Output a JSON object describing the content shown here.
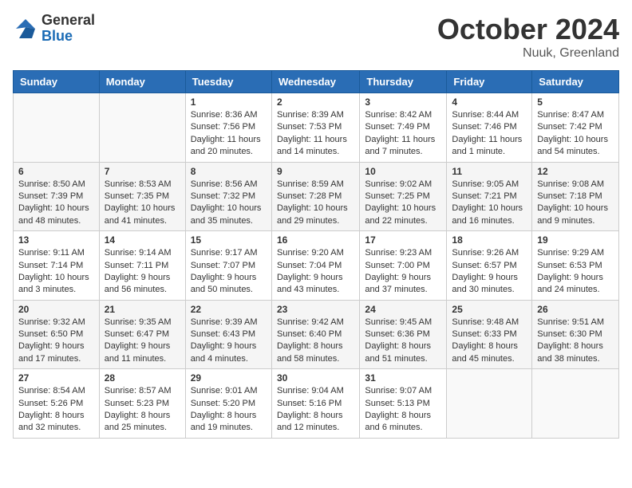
{
  "header": {
    "logo_general": "General",
    "logo_blue": "Blue",
    "month_title": "October 2024",
    "location": "Nuuk, Greenland"
  },
  "weekdays": [
    "Sunday",
    "Monday",
    "Tuesday",
    "Wednesday",
    "Thursday",
    "Friday",
    "Saturday"
  ],
  "rows": [
    [
      {
        "day": "",
        "lines": []
      },
      {
        "day": "",
        "lines": []
      },
      {
        "day": "1",
        "lines": [
          "Sunrise: 8:36 AM",
          "Sunset: 7:56 PM",
          "Daylight: 11 hours",
          "and 20 minutes."
        ]
      },
      {
        "day": "2",
        "lines": [
          "Sunrise: 8:39 AM",
          "Sunset: 7:53 PM",
          "Daylight: 11 hours",
          "and 14 minutes."
        ]
      },
      {
        "day": "3",
        "lines": [
          "Sunrise: 8:42 AM",
          "Sunset: 7:49 PM",
          "Daylight: 11 hours",
          "and 7 minutes."
        ]
      },
      {
        "day": "4",
        "lines": [
          "Sunrise: 8:44 AM",
          "Sunset: 7:46 PM",
          "Daylight: 11 hours",
          "and 1 minute."
        ]
      },
      {
        "day": "5",
        "lines": [
          "Sunrise: 8:47 AM",
          "Sunset: 7:42 PM",
          "Daylight: 10 hours",
          "and 54 minutes."
        ]
      }
    ],
    [
      {
        "day": "6",
        "lines": [
          "Sunrise: 8:50 AM",
          "Sunset: 7:39 PM",
          "Daylight: 10 hours",
          "and 48 minutes."
        ]
      },
      {
        "day": "7",
        "lines": [
          "Sunrise: 8:53 AM",
          "Sunset: 7:35 PM",
          "Daylight: 10 hours",
          "and 41 minutes."
        ]
      },
      {
        "day": "8",
        "lines": [
          "Sunrise: 8:56 AM",
          "Sunset: 7:32 PM",
          "Daylight: 10 hours",
          "and 35 minutes."
        ]
      },
      {
        "day": "9",
        "lines": [
          "Sunrise: 8:59 AM",
          "Sunset: 7:28 PM",
          "Daylight: 10 hours",
          "and 29 minutes."
        ]
      },
      {
        "day": "10",
        "lines": [
          "Sunrise: 9:02 AM",
          "Sunset: 7:25 PM",
          "Daylight: 10 hours",
          "and 22 minutes."
        ]
      },
      {
        "day": "11",
        "lines": [
          "Sunrise: 9:05 AM",
          "Sunset: 7:21 PM",
          "Daylight: 10 hours",
          "and 16 minutes."
        ]
      },
      {
        "day": "12",
        "lines": [
          "Sunrise: 9:08 AM",
          "Sunset: 7:18 PM",
          "Daylight: 10 hours",
          "and 9 minutes."
        ]
      }
    ],
    [
      {
        "day": "13",
        "lines": [
          "Sunrise: 9:11 AM",
          "Sunset: 7:14 PM",
          "Daylight: 10 hours",
          "and 3 minutes."
        ]
      },
      {
        "day": "14",
        "lines": [
          "Sunrise: 9:14 AM",
          "Sunset: 7:11 PM",
          "Daylight: 9 hours",
          "and 56 minutes."
        ]
      },
      {
        "day": "15",
        "lines": [
          "Sunrise: 9:17 AM",
          "Sunset: 7:07 PM",
          "Daylight: 9 hours",
          "and 50 minutes."
        ]
      },
      {
        "day": "16",
        "lines": [
          "Sunrise: 9:20 AM",
          "Sunset: 7:04 PM",
          "Daylight: 9 hours",
          "and 43 minutes."
        ]
      },
      {
        "day": "17",
        "lines": [
          "Sunrise: 9:23 AM",
          "Sunset: 7:00 PM",
          "Daylight: 9 hours",
          "and 37 minutes."
        ]
      },
      {
        "day": "18",
        "lines": [
          "Sunrise: 9:26 AM",
          "Sunset: 6:57 PM",
          "Daylight: 9 hours",
          "and 30 minutes."
        ]
      },
      {
        "day": "19",
        "lines": [
          "Sunrise: 9:29 AM",
          "Sunset: 6:53 PM",
          "Daylight: 9 hours",
          "and 24 minutes."
        ]
      }
    ],
    [
      {
        "day": "20",
        "lines": [
          "Sunrise: 9:32 AM",
          "Sunset: 6:50 PM",
          "Daylight: 9 hours",
          "and 17 minutes."
        ]
      },
      {
        "day": "21",
        "lines": [
          "Sunrise: 9:35 AM",
          "Sunset: 6:47 PM",
          "Daylight: 9 hours",
          "and 11 minutes."
        ]
      },
      {
        "day": "22",
        "lines": [
          "Sunrise: 9:39 AM",
          "Sunset: 6:43 PM",
          "Daylight: 9 hours",
          "and 4 minutes."
        ]
      },
      {
        "day": "23",
        "lines": [
          "Sunrise: 9:42 AM",
          "Sunset: 6:40 PM",
          "Daylight: 8 hours",
          "and 58 minutes."
        ]
      },
      {
        "day": "24",
        "lines": [
          "Sunrise: 9:45 AM",
          "Sunset: 6:36 PM",
          "Daylight: 8 hours",
          "and 51 minutes."
        ]
      },
      {
        "day": "25",
        "lines": [
          "Sunrise: 9:48 AM",
          "Sunset: 6:33 PM",
          "Daylight: 8 hours",
          "and 45 minutes."
        ]
      },
      {
        "day": "26",
        "lines": [
          "Sunrise: 9:51 AM",
          "Sunset: 6:30 PM",
          "Daylight: 8 hours",
          "and 38 minutes."
        ]
      }
    ],
    [
      {
        "day": "27",
        "lines": [
          "Sunrise: 8:54 AM",
          "Sunset: 5:26 PM",
          "Daylight: 8 hours",
          "and 32 minutes."
        ]
      },
      {
        "day": "28",
        "lines": [
          "Sunrise: 8:57 AM",
          "Sunset: 5:23 PM",
          "Daylight: 8 hours",
          "and 25 minutes."
        ]
      },
      {
        "day": "29",
        "lines": [
          "Sunrise: 9:01 AM",
          "Sunset: 5:20 PM",
          "Daylight: 8 hours",
          "and 19 minutes."
        ]
      },
      {
        "day": "30",
        "lines": [
          "Sunrise: 9:04 AM",
          "Sunset: 5:16 PM",
          "Daylight: 8 hours",
          "and 12 minutes."
        ]
      },
      {
        "day": "31",
        "lines": [
          "Sunrise: 9:07 AM",
          "Sunset: 5:13 PM",
          "Daylight: 8 hours",
          "and 6 minutes."
        ]
      },
      {
        "day": "",
        "lines": []
      },
      {
        "day": "",
        "lines": []
      }
    ]
  ]
}
